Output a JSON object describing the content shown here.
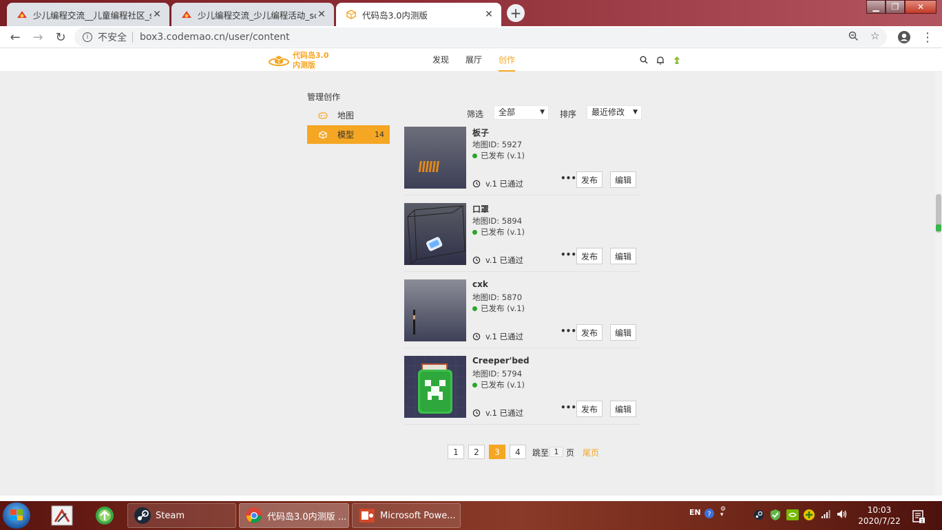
{
  "browser": {
    "tabs": [
      {
        "title": "少儿编程交流__儿童编程社区_scratch"
      },
      {
        "title": "少儿编程交流_少儿编程活动_scratch"
      },
      {
        "title": "代码岛3.0内测版"
      }
    ],
    "address": {
      "security_label": "不安全",
      "url": "box3.codemao.cn/user/content"
    }
  },
  "site": {
    "logo_line1": "代码岛3.0",
    "logo_line2": "内测版",
    "nav": [
      "发现",
      "展厅",
      "创作"
    ]
  },
  "sidebar": {
    "title": "管理创作",
    "items": [
      {
        "label": "地图",
        "count": ""
      },
      {
        "label": "模型",
        "count": "14"
      }
    ]
  },
  "filter": {
    "filter_label": "筛选",
    "filter_value": "全部",
    "sort_label": "排序",
    "sort_value": "最近修改"
  },
  "cards": [
    {
      "name": "板子",
      "map_id": "地图ID: 5927",
      "status": "已发布 (v.1)",
      "version": "v.1 已通过",
      "more": "•••",
      "publish": "发布",
      "edit": "编辑"
    },
    {
      "name": "口罩",
      "map_id": "地图ID: 5894",
      "status": "已发布 (v.1)",
      "version": "v.1 已通过",
      "more": "•••",
      "publish": "发布",
      "edit": "编辑"
    },
    {
      "name": "cxk",
      "map_id": "地图ID: 5870",
      "status": "已发布 (v.1)",
      "version": "v.1 已通过",
      "more": "•••",
      "publish": "发布",
      "edit": "编辑"
    },
    {
      "name": "Creeper'bed",
      "map_id": "地图ID: 5794",
      "status": "已发布 (v.1)",
      "version": "v.1 已通过",
      "more": "•••",
      "publish": "发布",
      "edit": "编辑"
    }
  ],
  "pagination": {
    "pages": [
      "1",
      "2",
      "3",
      "4"
    ],
    "current": "3",
    "jump_prefix": "跳至",
    "jump_value": "1",
    "jump_suffix": "页",
    "last": "尾页"
  },
  "taskbar": {
    "apps": [
      {
        "label": "Steam"
      },
      {
        "label": "代码岛3.0内测版 ..."
      },
      {
        "label": "Microsoft Powe..."
      }
    ],
    "lang": "EN",
    "time": "10:03",
    "date": "2020/7/22"
  },
  "colors": {
    "accent": "#f5a623",
    "published": "#2aa52a"
  }
}
